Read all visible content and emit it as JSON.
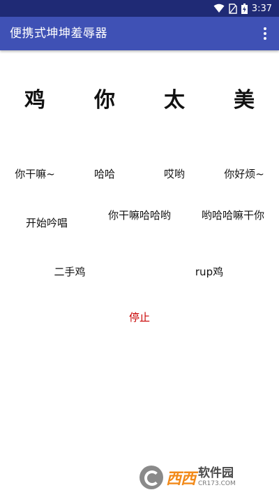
{
  "status_bar": {
    "time": "3:37"
  },
  "app_bar": {
    "title": "便携式坤坤羞辱器"
  },
  "big_chars": [
    "鸡",
    "你",
    "太",
    "美"
  ],
  "buttons_row1": [
    "你干嘛~",
    "哈哈",
    "哎哟",
    "你好烦~"
  ],
  "buttons_row2": [
    "开始吟唱",
    "你干嘛哈哈哟",
    "哟哈哈嘛干你"
  ],
  "buttons_row3": [
    "二手鸡",
    "rup鸡"
  ],
  "stop_label": "停止",
  "watermark": {
    "logo_text": "西西",
    "name": "软件园",
    "url": "CR173.COM"
  }
}
